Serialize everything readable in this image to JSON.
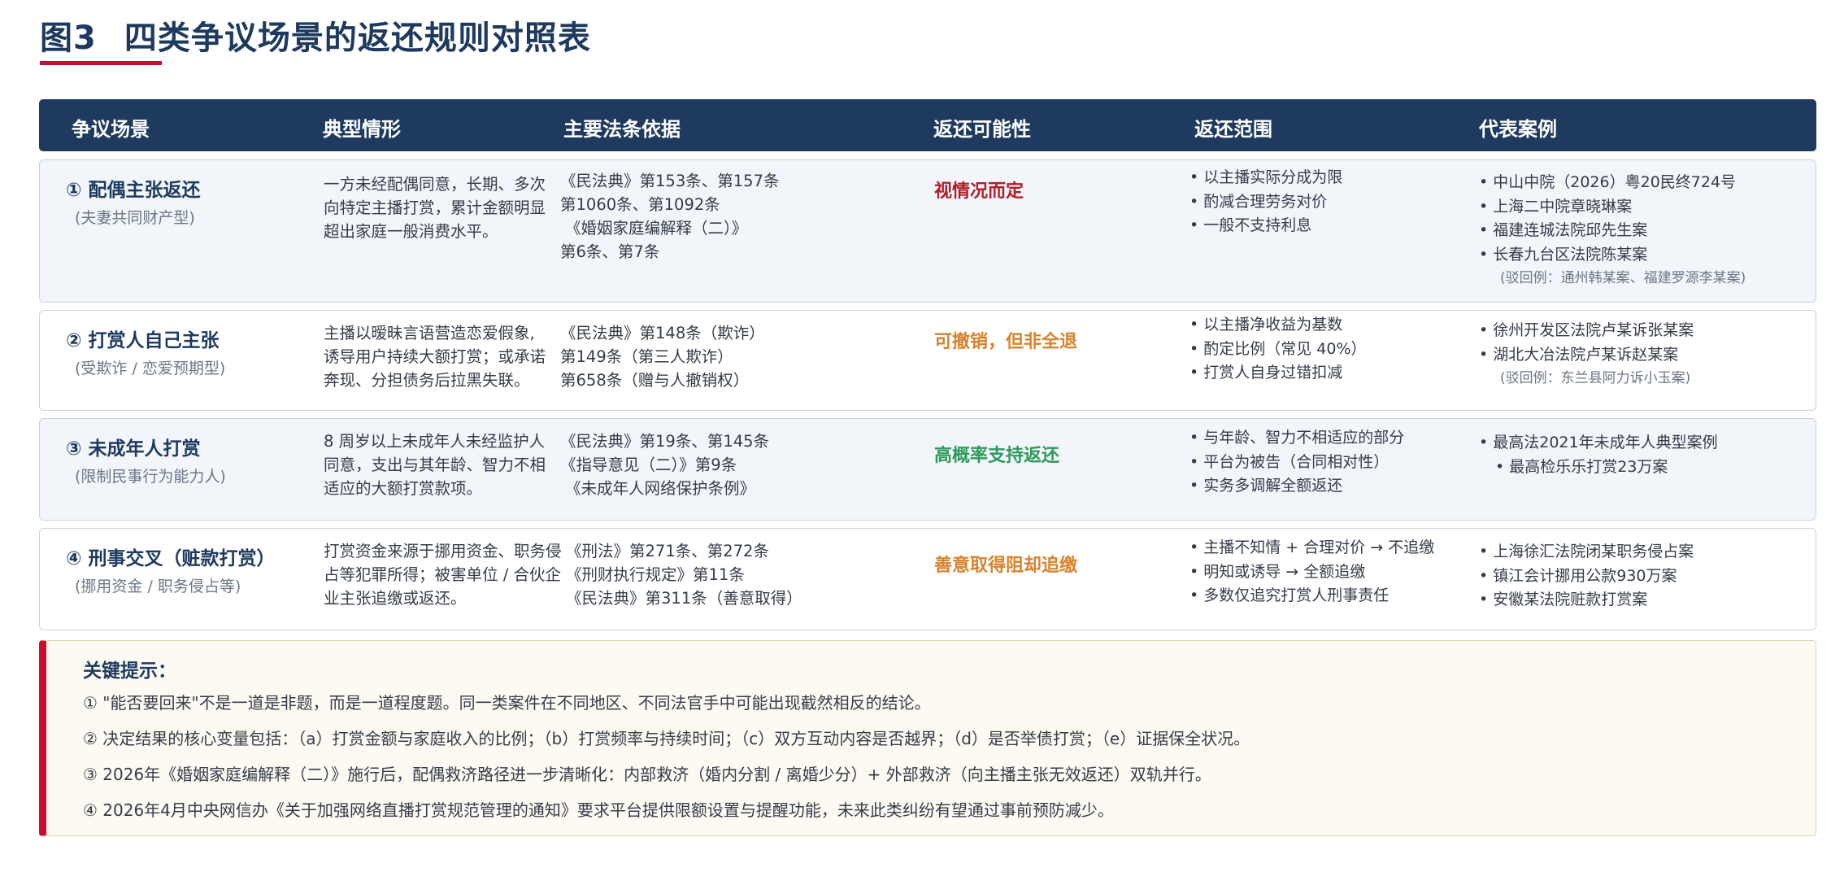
{
  "title": {
    "figure": "图3",
    "text": "四类争议场景的返还规则对照表"
  },
  "headers": [
    "争议场景",
    "典型情形",
    "主要法条依据",
    "返还可能性",
    "返还范围",
    "代表案例"
  ],
  "colors": {
    "navy": "#1e3a5f",
    "accent_red": "#c8102e",
    "dark_red": "#b01e2a",
    "orange": "#d9822b",
    "green": "#2e9a5b"
  },
  "rows": [
    {
      "scene": "① 配偶主张返还",
      "scene_sub": "(夫妻共同财产型)",
      "situation": [
        "一方未经配偶同意，长期、多次",
        "向特定主播打赏，累计金额明显",
        "超出家庭一般消费水平。"
      ],
      "law": [
        "《民法典》第153条、第157条",
        "第1060条、第1092条",
        "《婚姻家庭编解释（二）》",
        "第6条、第7条"
      ],
      "possibility": "视情况而定",
      "possibility_color": "#b01e2a",
      "scope": [
        "以主播实际分成为限",
        "酌减合理劳务对价",
        "一般不支持利息"
      ],
      "cases": [
        "中山中院（2026）粤20民终724号",
        "上海二中院章晓琳案",
        "福建连城法院邱先生案",
        "长春九台区法院陈某案"
      ],
      "case_note": "(驳回例：通州韩某案、福建罗源李某案)"
    },
    {
      "scene": "② 打赏人自己主张",
      "scene_sub": "(受欺诈 / 恋爱预期型)",
      "situation": [
        "主播以暧昧言语营造恋爱假象,",
        "诱导用户持续大额打赏；或承诺",
        "奔现、分担债务后拉黑失联。"
      ],
      "law": [
        "《民法典》第148条（欺诈）",
        "第149条（第三人欺诈）",
        "第658条（赠与人撤销权）"
      ],
      "possibility": "可撤销，但非全退",
      "possibility_color": "#d9822b",
      "scope": [
        "以主播净收益为基数",
        "酌定比例（常见 40%）",
        "打赏人自身过错扣减"
      ],
      "cases": [
        "徐州开发区法院卢某诉张某案",
        "湖北大冶法院卢某诉赵某案"
      ],
      "case_note": "(驳回例：东兰县阿力诉小玉案)"
    },
    {
      "scene": "③ 未成年人打赏",
      "scene_sub": "(限制民事行为能力人)",
      "situation": [
        "8 周岁以上未成年人未经监护人",
        "同意，支出与其年龄、智力不相",
        "适应的大额打赏款项。"
      ],
      "law": [
        "《民法典》第19条、第145条",
        "《指导意见（二）》第9条",
        "《未成年人网络保护条例》"
      ],
      "possibility": "高概率支持返还",
      "possibility_color": "#2e9a5b",
      "scope": [
        "与年龄、智力不相适应的部分",
        "平台为被告（合同相对性）",
        "实务多调解全额返还"
      ],
      "cases": [
        "最高法2021年未成年人典型案例",
        "最高检乐乐打赏23万案"
      ],
      "case_note": ""
    },
    {
      "scene": "④ 刑事交叉（赃款打赏）",
      "scene_sub": "(挪用资金 / 职务侵占等)",
      "situation": [
        "打赏资金来源于挪用资金、职务侵",
        "占等犯罪所得；被害单位 / 合伙企",
        "业主张追缴或返还。"
      ],
      "law": [
        "《刑法》第271条、第272条",
        "《刑财执行规定》第11条",
        "《民法典》第311条（善意取得）"
      ],
      "possibility": "善意取得阻却追缴",
      "possibility_color": "#d9822b",
      "scope": [
        "主播不知情 + 合理对价 → 不追缴",
        "明知或诱导 → 全额追缴",
        "多数仅追究打赏人刑事责任"
      ],
      "cases": [
        "上海徐汇法院闭某职务侵占案",
        "镇江会计挪用公款930万案",
        "安徽某法院赃款打赏案"
      ],
      "case_note": ""
    }
  ],
  "tips": {
    "title": "关键提示：",
    "items": [
      "① \"能否要回来\"不是一道是非题，而是一道程度题。同一类案件在不同地区、不同法官手中可能出现截然相反的结论。",
      "② 决定结果的核心变量包括：（a）打赏金额与家庭收入的比例；（b）打赏频率与持续时间；（c）双方互动内容是否越界；（d）是否举债打赏；（e）证据保全状况。",
      "③ 2026年《婚姻家庭编解释（二）》施行后，配偶救济路径进一步清晰化：内部救济（婚内分割 / 离婚少分）+ 外部救济（向主播主张无效返还）双轨并行。",
      "④ 2026年4月中央网信办《关于加强网络直播打赏规范管理的通知》要求平台提供限额设置与提醒功能，未来此类纠纷有望通过事前预防减少。"
    ]
  }
}
